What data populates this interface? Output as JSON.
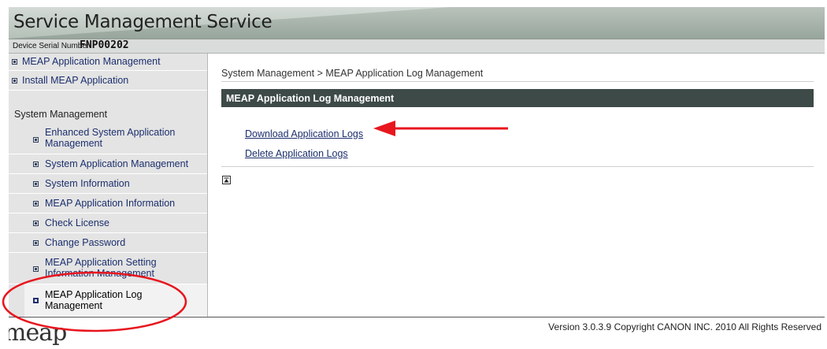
{
  "header": {
    "title": "Service Management Service"
  },
  "device": {
    "serial_label": "Device Serial Number:",
    "serial_value": "FNP00202"
  },
  "sidebar": {
    "items": [
      {
        "label": "MEAP Application Management"
      },
      {
        "label": "Install MEAP Application"
      }
    ],
    "section_label": "System Management",
    "sub_items": [
      {
        "label_line1": "Enhanced System Application",
        "label_line2": "Management"
      },
      {
        "label": "System Application Management"
      },
      {
        "label": "System Information"
      },
      {
        "label": "MEAP Application Information"
      },
      {
        "label": "Check License"
      },
      {
        "label": "Change Password"
      },
      {
        "label_line1": "MEAP Application Setting",
        "label_line2": "Information Management"
      },
      {
        "label_line1": "MEAP Application Log",
        "label_line2": "Management",
        "active": true
      }
    ]
  },
  "main": {
    "breadcrumb": "System Management > MEAP Application Log Management",
    "section_title": "MEAP Application Log Management",
    "links": [
      {
        "label": "Download Application Logs"
      },
      {
        "label": "Delete Application Logs"
      }
    ]
  },
  "footer": {
    "logo_text": "meap",
    "version": "Version 3.0.3.9 Copyright CANON INC. 2010 All Rights Reserved"
  },
  "annotations": {
    "arrow_color": "#e8161e",
    "circle_color": "#e8161e"
  },
  "icons": {
    "nav_bullet": "square-bullet-icon",
    "top_button": "scroll-to-top-icon"
  }
}
